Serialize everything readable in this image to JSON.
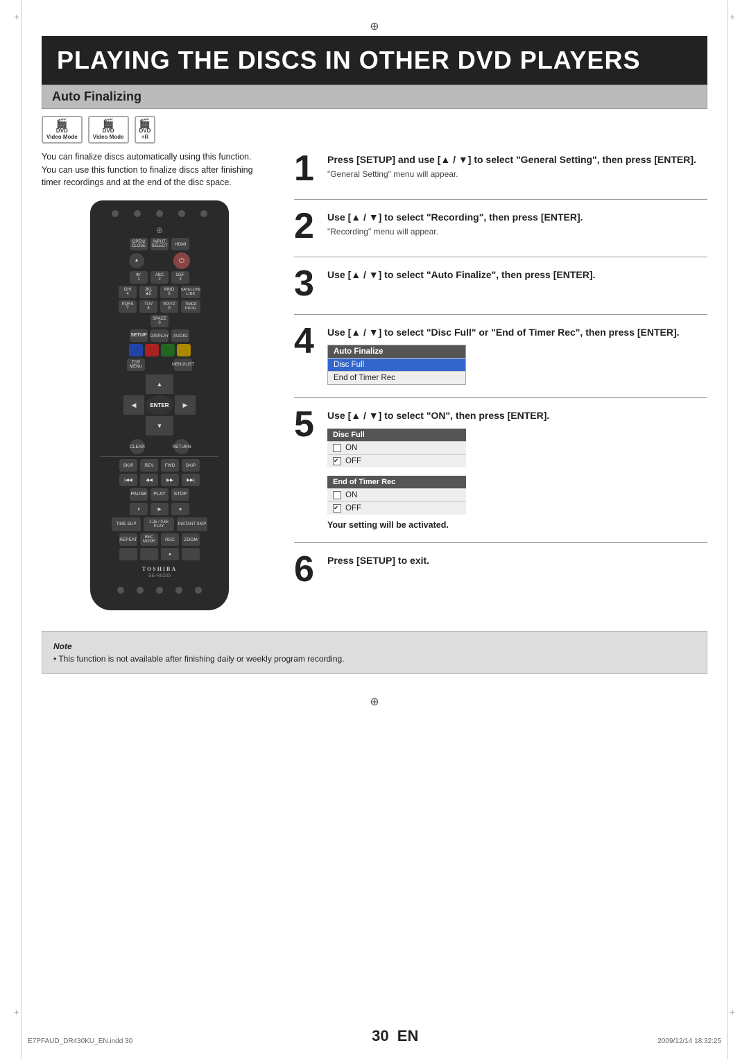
{
  "page": {
    "title": "PLAYING THE DISCS IN OTHER DVD PLAYERS",
    "section": "Auto Finalizing",
    "page_number": "30",
    "page_suffix": "EN",
    "reg_mark_top": "⊕",
    "reg_mark_bottom": "⊕",
    "footer_left": "E7PFAUD_DR430KU_EN.indd  30",
    "footer_right": "2009/12/14  18:32:25"
  },
  "dvd_logos": [
    {
      "top": "DVD",
      "bottom": "Video Mode"
    },
    {
      "top": "DVD",
      "bottom": "Video Mode"
    },
    {
      "top": "DVD",
      "bottom": "+R"
    }
  ],
  "intro": {
    "line1": "You can finalize discs automatically using this function.",
    "line2": "You can use this function to finalize discs after finishing",
    "line3": "timer recordings and at the end of the disc space."
  },
  "remote": {
    "brand": "TOSHIBA",
    "model": "SE-R0265"
  },
  "steps": [
    {
      "number": "1",
      "title": "Press [SETUP] and use [▲ / ▼] to select \"General Setting\", then press [ENTER].",
      "sub": "\"General Setting\" menu will appear."
    },
    {
      "number": "2",
      "title": "Use [▲ / ▼] to select \"Recording\", then press [ENTER].",
      "sub": "\"Recording\" menu will appear."
    },
    {
      "number": "3",
      "title": "Use [▲ / ▼] to select \"Auto Finalize\", then press [ENTER].",
      "sub": ""
    },
    {
      "number": "4",
      "title": "Use [▲ / ▼] to select \"Disc Full\" or \"End of Timer Rec\", then press [ENTER].",
      "sub": ""
    },
    {
      "number": "5",
      "title": "Use [▲ / ▼] to select \"ON\", then press [ENTER].",
      "sub": ""
    },
    {
      "number": "6",
      "title": "Press [SETUP] to exit.",
      "sub": ""
    }
  ],
  "menu_step4": {
    "header": "Auto Finalize",
    "items": [
      "Disc Full",
      "End of Timer Rec"
    ],
    "selected": "Disc Full"
  },
  "menu_step5_discfull": {
    "title": "Disc Full",
    "on_label": "ON",
    "off_label": "OFF",
    "on_checked": false,
    "off_checked": true
  },
  "menu_step5_endtimer": {
    "title": "End of Timer Rec",
    "on_label": "ON",
    "off_label": "OFF",
    "on_checked": false,
    "off_checked": true
  },
  "activated_text": "Your setting will be activated.",
  "note": {
    "label": "Note",
    "text": "This function is not available after finishing daily or weekly program recording."
  }
}
